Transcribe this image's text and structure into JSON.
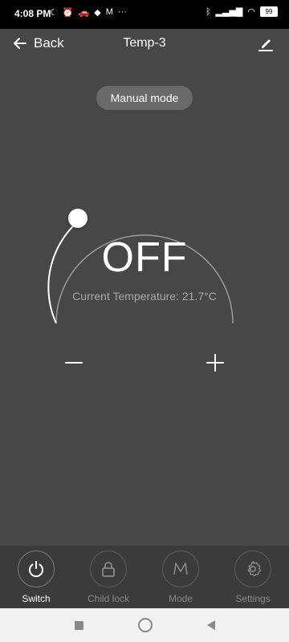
{
  "status_bar": {
    "time": "4:08 PM",
    "battery": "99"
  },
  "header": {
    "back_label": "Back",
    "title": "Temp-3"
  },
  "mode_badge": "Manual mode",
  "dial": {
    "state": "OFF",
    "current_temperature": "Current Temperature: 21.7°C"
  },
  "tabs": [
    {
      "label": "Switch",
      "icon": "power-icon",
      "active": true
    },
    {
      "label": "Child lock",
      "icon": "lock-icon",
      "active": false
    },
    {
      "label": "Mode",
      "icon": "mode-m-icon",
      "active": false
    },
    {
      "label": "Settings",
      "icon": "gear-icon",
      "active": false
    }
  ],
  "colors": {
    "background": "#474747",
    "tab_bar": "#3b3b3b",
    "active_label": "#ffffff",
    "inactive_label": "#8a8a8a"
  }
}
